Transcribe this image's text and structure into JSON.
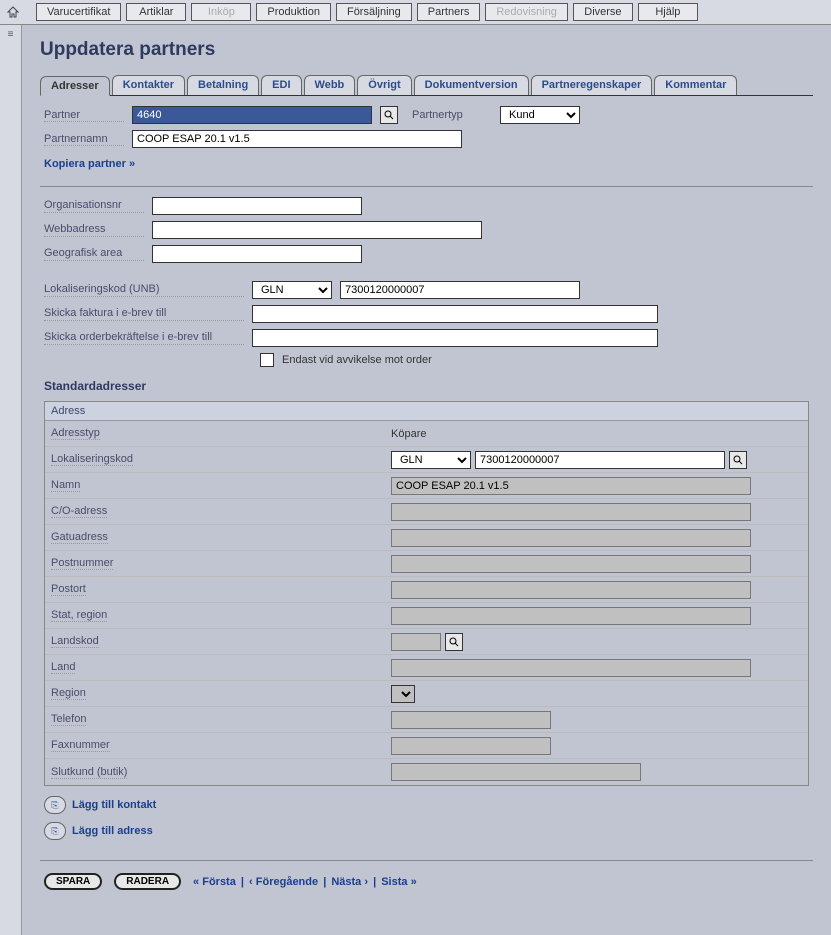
{
  "topnav": {
    "items": [
      {
        "label": "Varucertifikat",
        "disabled": false
      },
      {
        "label": "Artiklar",
        "disabled": false
      },
      {
        "label": "Inköp",
        "disabled": true
      },
      {
        "label": "Produktion",
        "disabled": false
      },
      {
        "label": "Försäljning",
        "disabled": false
      },
      {
        "label": "Partners",
        "disabled": false
      },
      {
        "label": "Redovisning",
        "disabled": true
      },
      {
        "label": "Diverse",
        "disabled": false
      },
      {
        "label": "Hjälp",
        "disabled": false
      }
    ]
  },
  "page": {
    "title": "Uppdatera partners"
  },
  "tabs": [
    {
      "label": "Adresser",
      "active": true
    },
    {
      "label": "Kontakter"
    },
    {
      "label": "Betalning"
    },
    {
      "label": "EDI"
    },
    {
      "label": "Webb"
    },
    {
      "label": "Övrigt"
    },
    {
      "label": "Dokumentversion"
    },
    {
      "label": "Partneregenskaper"
    },
    {
      "label": "Kommentar"
    }
  ],
  "form": {
    "partner_label": "Partner",
    "partner_value": "4640",
    "partnertyp_label": "Partnertyp",
    "partnertyp_value": "Kund",
    "partnernamn_label": "Partnernamn",
    "partnernamn_value": "COOP ESAP 20.1 v1.5",
    "copy_link": "Kopiera partner »",
    "orgnr_label": "Organisationsnr",
    "orgnr_value": "",
    "webb_label": "Webbadress",
    "webb_value": "",
    "geo_label": "Geografisk area",
    "geo_value": "",
    "lokkod_label": "Lokaliseringskod (UNB)",
    "lokkod_type": "GLN",
    "lokkod_value": "7300120000007",
    "faktura_label": "Skicka faktura i e-brev till",
    "faktura_value": "",
    "orderbek_label": "Skicka orderbekräftelse i e-brev till",
    "orderbek_value": "",
    "avvikelse_label": "Endast vid avvikelse mot order"
  },
  "addresses": {
    "heading": "Standardadresser",
    "box_title": "Adress",
    "rows": {
      "adresstyp": {
        "label": "Adresstyp",
        "value": "Köpare"
      },
      "lokkod": {
        "label": "Lokaliseringskod",
        "type": "GLN",
        "value": "7300120000007"
      },
      "namn": {
        "label": "Namn",
        "value": "COOP ESAP 20.1 v1.5"
      },
      "co": {
        "label": "C/O-adress",
        "value": ""
      },
      "gatu": {
        "label": "Gatuadress",
        "value": ""
      },
      "postnr": {
        "label": "Postnummer",
        "value": ""
      },
      "postort": {
        "label": "Postort",
        "value": ""
      },
      "stat": {
        "label": "Stat, region",
        "value": ""
      },
      "landskod": {
        "label": "Landskod",
        "value": ""
      },
      "land": {
        "label": "Land",
        "value": ""
      },
      "region": {
        "label": "Region",
        "value": ""
      },
      "telefon": {
        "label": "Telefon",
        "value": ""
      },
      "fax": {
        "label": "Faxnummer",
        "value": ""
      },
      "slutkund": {
        "label": "Slutkund (butik)",
        "value": ""
      }
    },
    "add_contact": "Lägg till kontakt",
    "add_address": "Lägg till adress"
  },
  "footer": {
    "save": "SPARA",
    "delete": "RADERA",
    "pager": {
      "first": "« Första",
      "prev": "‹ Föregående",
      "next": "Nästa ›",
      "last": "Sista »"
    }
  }
}
